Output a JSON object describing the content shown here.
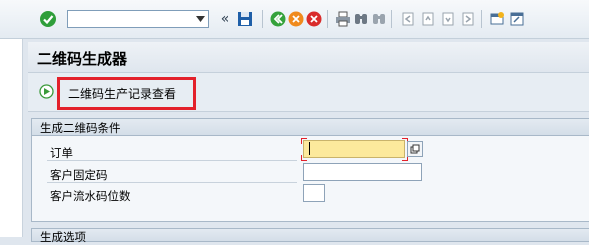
{
  "toolbar": {
    "command_field_value": "",
    "icons": [
      "check-icon",
      "back-icon",
      "save-icon",
      "green-back-icon",
      "exit-icon",
      "cancel-icon",
      "print-icon",
      "find-icon",
      "find-next-icon",
      "first-page-icon",
      "prev-page-icon",
      "next-page-icon",
      "last-page-icon",
      "new-session-icon",
      "shortcut-icon"
    ]
  },
  "title": "二维码生成器",
  "app_toolbar": {
    "button_label": "二维码生产记录查看"
  },
  "group1": {
    "title": "生成二维码条件",
    "fields": [
      {
        "label": "订单",
        "value": "",
        "required": true
      },
      {
        "label": "客户固定码",
        "value": ""
      },
      {
        "label": "客户流水码位数",
        "value": ""
      }
    ]
  },
  "group2": {
    "title": "生成选项"
  },
  "colors": {
    "highlight_border": "#e3212b",
    "required_field": "#fce99c"
  }
}
